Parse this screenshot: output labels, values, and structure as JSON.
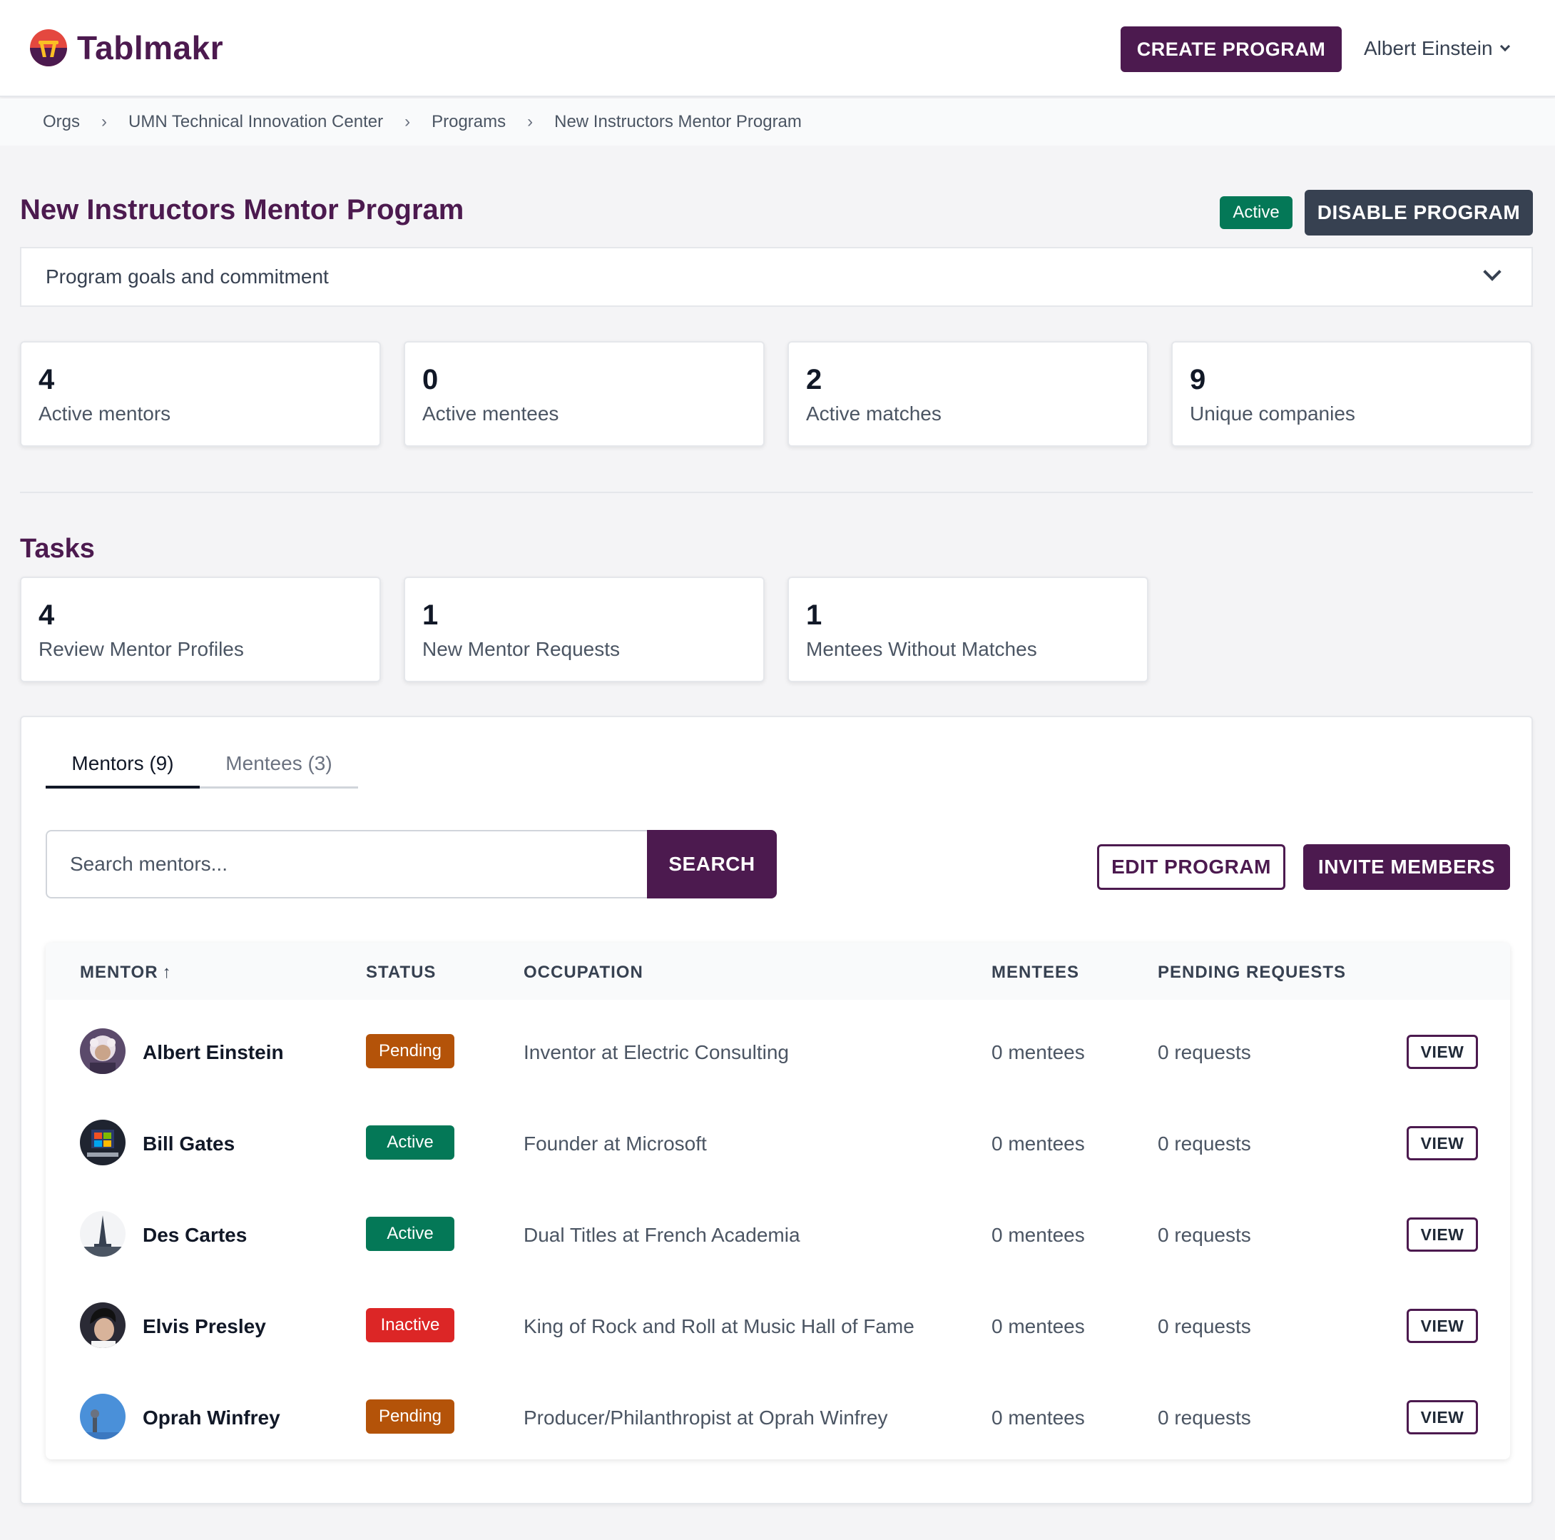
{
  "app": {
    "name": "Tablmakr"
  },
  "header": {
    "create_label": "CREATE PROGRAM",
    "user_name": "Albert Einstein"
  },
  "breadcrumb": [
    "Orgs",
    "UMN Technical Innovation Center",
    "Programs",
    "New Instructors Mentor Program"
  ],
  "page": {
    "title": "New Instructors Mentor Program",
    "status": "Active",
    "disable_label": "DISABLE PROGRAM",
    "accordion_label": "Program goals and commitment"
  },
  "stats": [
    {
      "value": "4",
      "label": "Active mentors"
    },
    {
      "value": "0",
      "label": "Active mentees"
    },
    {
      "value": "2",
      "label": "Active matches"
    },
    {
      "value": "9",
      "label": "Unique companies"
    }
  ],
  "tasks": {
    "title": "Tasks",
    "items": [
      {
        "value": "4",
        "label": "Review Mentor Profiles"
      },
      {
        "value": "1",
        "label": "New Mentor Requests"
      },
      {
        "value": "1",
        "label": "Mentees Without Matches"
      }
    ]
  },
  "tabs": [
    {
      "label": "Mentors (9)"
    },
    {
      "label": "Mentees (3)"
    }
  ],
  "search": {
    "placeholder": "Search mentors...",
    "button_label": "SEARCH"
  },
  "actions": {
    "edit_label": "EDIT PROGRAM",
    "invite_label": "INVITE MEMBERS"
  },
  "table": {
    "columns": [
      "MENTOR",
      "STATUS",
      "OCCUPATION",
      "MENTEES",
      "PENDING REQUESTS"
    ],
    "sort_indicator": "↑",
    "view_label": "VIEW",
    "rows": [
      {
        "name": "Albert Einstein",
        "status": "Pending",
        "occupation": "Inventor at Electric Consulting",
        "mentees": "0 mentees",
        "requests": "0 requests"
      },
      {
        "name": "Bill Gates",
        "status": "Active",
        "occupation": "Founder at Microsoft",
        "mentees": "0 mentees",
        "requests": "0 requests"
      },
      {
        "name": "Des Cartes",
        "status": "Active",
        "occupation": "Dual Titles at French Academia",
        "mentees": "0 mentees",
        "requests": "0 requests"
      },
      {
        "name": "Elvis Presley",
        "status": "Inactive",
        "occupation": "King of Rock and Roll at Music Hall of Fame",
        "mentees": "0 mentees",
        "requests": "0 requests"
      },
      {
        "name": "Oprah Winfrey",
        "status": "Pending",
        "occupation": "Producer/Philanthropist at Oprah Winfrey",
        "mentees": "0 mentees",
        "requests": "0 requests"
      }
    ]
  },
  "colors": {
    "brand": "#4c1a4f",
    "active": "#047857",
    "pending": "#b45309",
    "inactive": "#dc2626",
    "dark_button": "#374151"
  }
}
